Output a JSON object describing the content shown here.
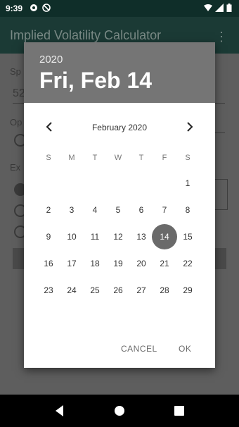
{
  "status": {
    "time": "9:39"
  },
  "app": {
    "title": "Implied Volatility Calculator"
  },
  "background": {
    "label1": "Sp",
    "value1": "52",
    "label2": "Op",
    "label3": "Ex"
  },
  "dialog": {
    "year": "2020",
    "date": "Fri, Feb 14",
    "month_label": "February 2020",
    "weekdays": [
      "S",
      "M",
      "T",
      "W",
      "T",
      "F",
      "S"
    ],
    "weeks": [
      [
        "",
        "",
        "",
        "",
        "",
        "",
        "1"
      ],
      [
        "2",
        "3",
        "4",
        "5",
        "6",
        "7",
        "8"
      ],
      [
        "9",
        "10",
        "11",
        "12",
        "13",
        "14",
        "15"
      ],
      [
        "16",
        "17",
        "18",
        "19",
        "20",
        "21",
        "22"
      ],
      [
        "23",
        "24",
        "25",
        "26",
        "27",
        "28",
        "29"
      ]
    ],
    "selected_day": "14",
    "cancel_label": "CANCEL",
    "ok_label": "OK"
  },
  "icons": {
    "status_left": [
      "notification-icon",
      "do-not-disturb-icon"
    ],
    "status_right": [
      "wifi-icon",
      "signal-icon",
      "battery-icon"
    ],
    "nav": [
      "back-icon",
      "home-icon",
      "recents-icon"
    ]
  }
}
